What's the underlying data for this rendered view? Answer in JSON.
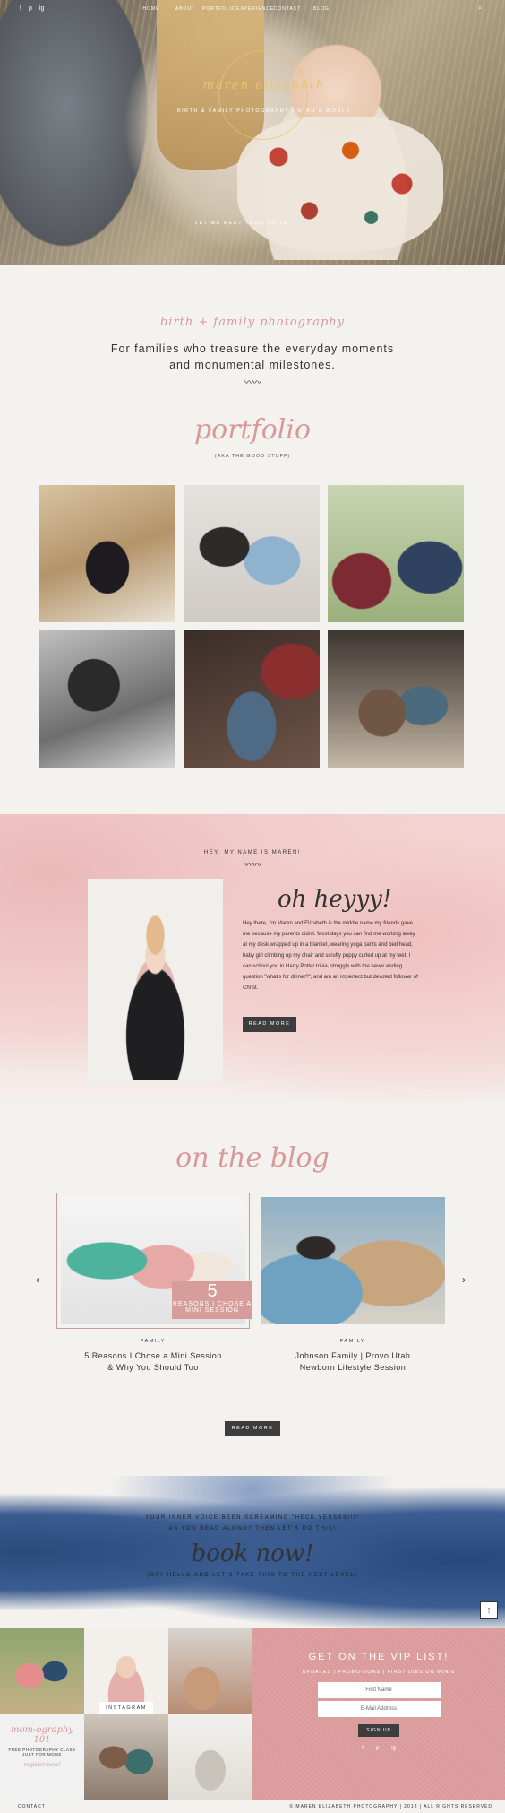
{
  "nav": {
    "social": [
      "f",
      "p",
      "ig"
    ],
    "links": [
      "HOME",
      "ABOUT",
      "PORTFOLIO",
      "EXPERIENCE",
      "CONTACT",
      "BLOG"
    ],
    "search_icon": "search-icon"
  },
  "hero": {
    "logo": "maren elizabeth",
    "tagline": "BIRTH & FAMILY PHOTOGRAPHY | UTAH & WORLD",
    "meet": "LET ME MEET YOUR CHILD"
  },
  "intro": {
    "script": "birth + family photography",
    "lead_line1": "For families who treasure the everyday moments",
    "lead_line2": "and monumental milestones.",
    "squiggle": "〰〰"
  },
  "portfolio": {
    "title": "portfolio",
    "subtitle": "(AKA THE GOOD STUFF)"
  },
  "about": {
    "hey": "HEY, MY NAME IS MAREN!",
    "squiggle": "〰〰",
    "heading": "oh heyyy!",
    "bio": "Hey there, I'm Maren and Elizabeth is the middle name my friends gave me because my parents didn't. Most days you can find me working away at my desk wrapped up in a blanket, wearing yoga pants and bed head, baby girl climbing up my chair and scruffy puppy curled up at my feet. I can school you in Harry Potter trivia, struggle with the never ending question \"what's for dinner?\", and am an imperfect but devoted follower of Christ.",
    "read_more": "READ MORE"
  },
  "blog": {
    "title": "on the blog",
    "prev": "‹",
    "next": "›",
    "posts": [
      {
        "category": "FAMILY",
        "title_line1": "5 Reasons I Chose a Mini Session",
        "title_line2": "& Why You Should Too",
        "badge_number": "5",
        "badge_text": "REASONS I CHOSE A MINI SESSION"
      },
      {
        "category": "FAMILY",
        "title_line1": "Johnson Family | Provo Utah",
        "title_line2": "Newborn Lifestyle Session"
      }
    ],
    "read_more": "READ MORE"
  },
  "book": {
    "line1": "YOUR INNER VOICE BEEN SCREAMING \"HECK YESSSS!!!\"",
    "line2": "AS YOU READ ALONG? THEN LET'S DO THIS!",
    "title": "book now!",
    "line3": "(SAY HELLO AND LET'S TAKE THIS TO THE NEXT LEVEL)",
    "to_top": "↑"
  },
  "instagram": {
    "label": "INSTAGRAM",
    "mini_script": "mom-ography 101",
    "mini_free": "FREE PHOTOGRAPHY CLASS JUST FOR MOMS",
    "mini_sign": "register now!"
  },
  "vip": {
    "heading": "GET ON THE VIP LIST!",
    "subtitle": "UPDATES | PROMOTIONS | FIRST DIBS ON MINIS",
    "first_name_placeholder": "First Name",
    "email_placeholder": "E-Mail Address",
    "signup": "SIGN UP",
    "icons": [
      "f",
      "p",
      "ig"
    ]
  },
  "footer": {
    "left": "CONTACT",
    "right": "© MAREN ELIZABETH PHOTOGRAPHY | 2018 | ALL RIGHTS RESERVED"
  }
}
